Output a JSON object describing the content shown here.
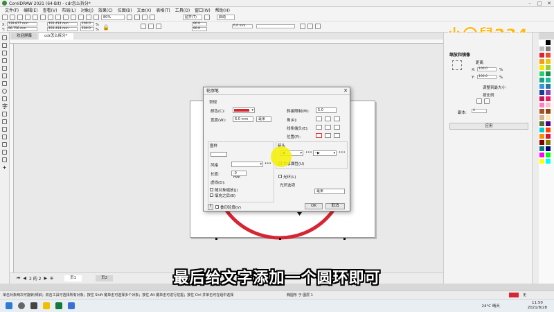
{
  "window": {
    "title": "CorelDRAW 2021 (64-Bit) - cdr怎么拆分*"
  },
  "menu": [
    "文件(F)",
    "编辑(E)",
    "查看(V)",
    "布局(L)",
    "对象(J)",
    "效果(C)",
    "位图(B)",
    "文本(X)",
    "表格(T)",
    "工具(O)",
    "窗口(W)",
    "帮助(H)"
  ],
  "std_toolbar": {
    "zoom": "80%",
    "snap_label": "贴齐(T)",
    "launch_label": "启动"
  },
  "prop_bar": {
    "x": "139.877 mm",
    "y": "96.756 mm",
    "w": "191.414 mm",
    "h": "191.414 mm",
    "sx": "100.0",
    "sy": "100.0",
    "unit_pct": "%",
    "angle1": "90.0",
    "angle2": "90.0",
    "outline": "6.0 mm"
  },
  "tabs": [
    "欢迎屏幕",
    "cdr怎么拆分*"
  ],
  "dialog": {
    "title": "轮廓笔",
    "general": "常规",
    "color_label": "颜色(C):",
    "width_label": "宽度(W):",
    "width_value": "6.0 mm",
    "unit_value": "毫米",
    "miter_label": "斜接限制(M):",
    "miter_value": "5.0",
    "corner_label": "角(R):",
    "linecap_label": "线条端头(E):",
    "position_label": "位置(P):",
    "pattern_group": "图样",
    "style_label": "风格",
    "length_label": "长度:",
    "length_value": ".0 mm",
    "dash_label": "虚线(D):",
    "scale_label": "随对象缩放(J)",
    "fill_behind_label": "填充之后(B)",
    "arrow_group": "箭头",
    "share_attr_label": "共享属性(U)",
    "halo_label": "光环(L)",
    "halo_options_label": "光环选项",
    "halo_unit": "毫米",
    "overprint_label": "叠印轮廓(V)",
    "ok": "OK",
    "cancel": "取消",
    "color": "#d62633"
  },
  "docker": {
    "title": "缩放和镜像",
    "distance_label": "距离",
    "x_label": "X:",
    "y_label": "Y:",
    "x_value": "100.0",
    "y_value": "100.0",
    "pct": "%",
    "lock_ratio": "调整到最大小",
    "proportional": "按比例",
    "copies_label": "副本:",
    "copies_value": "4",
    "apply": "应用"
  },
  "page_nav": {
    "counter": "2 的 2",
    "pages": [
      "页1",
      "页2"
    ]
  },
  "status": {
    "hint": "单击对象两次可旋转/倾斜；双击工具可选择所有对象；按住 Shift 键单击可选择多个对象；按住 Alt 键单击可进行挖掘；按住 Ctrl 并单击可在组中选择",
    "layer": "椭圆形 于 图层 1",
    "fill_none": "无"
  },
  "taskbar": {
    "weather": "24°C 晴天",
    "time": "11:50",
    "date": "2021/8/28"
  },
  "subtitle": "最后给文字添加一个圆环即可",
  "watermark": "小〇鼠234",
  "palette_colors": [
    "#ffffff",
    "#000000",
    "#c0c0c0",
    "#7f7f7f",
    "#d62633",
    "#e84c3d",
    "#f39c12",
    "#f1c40f",
    "#f7e600",
    "#9acd32",
    "#2ecc71",
    "#1e8449",
    "#16a085",
    "#1abc9c",
    "#3498db",
    "#2874a6",
    "#1f3a93",
    "#8e44ad",
    "#c2185b",
    "#e91e63",
    "#ff7fbf",
    "#ffc0cb",
    "#a0522d",
    "#8b4513",
    "#d2b48c",
    "#ffe4b5",
    "#556b2f",
    "#4b0082",
    "#00ced1",
    "#ff4500",
    "#ff8c00",
    "#dc143c",
    "#800000",
    "#808000",
    "#008080",
    "#000080",
    "#ff00ff",
    "#00ff00",
    "#ffff00",
    "#00ffff"
  ]
}
